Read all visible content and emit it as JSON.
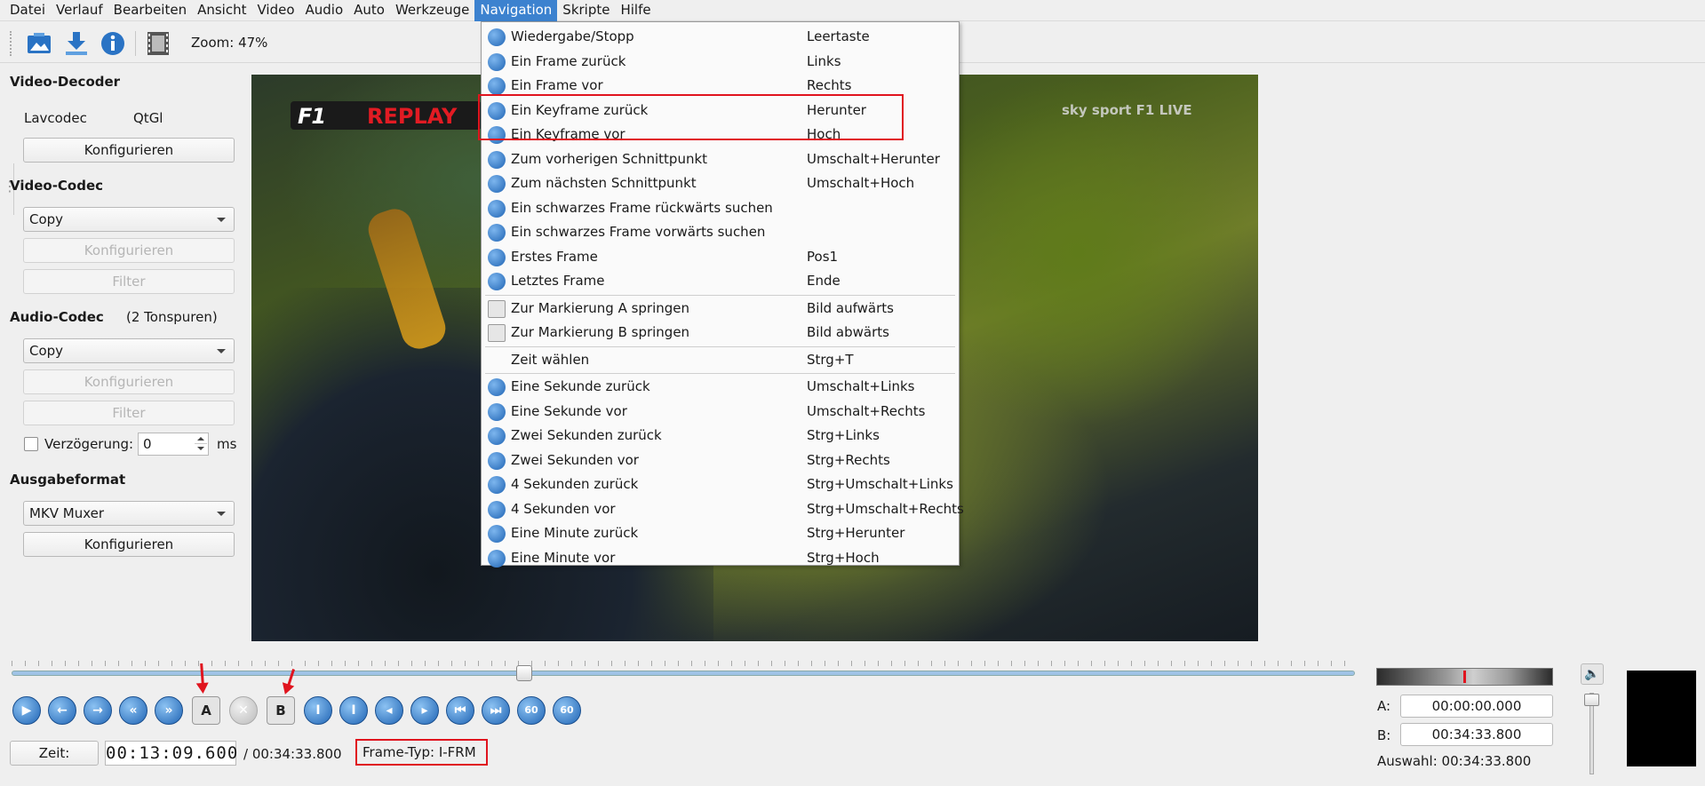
{
  "menubar": [
    "Datei",
    "Verlauf",
    "Bearbeiten",
    "Ansicht",
    "Video",
    "Audio",
    "Auto",
    "Werkzeuge",
    "Navigation",
    "Skripte",
    "Hilfe"
  ],
  "toolbar": {
    "zoom": "Zoom: 47%"
  },
  "left": {
    "video_decoder": "Video-Decoder",
    "lavcodec": "Lavcodec",
    "qtgl": "QtGl",
    "configure": "Konfigurieren",
    "video_codec": "Video-Codec",
    "copy": "Copy",
    "filter": "Filter",
    "audio_codec": "Audio-Codec",
    "tracks": "(2 Tonspuren)",
    "delay": "Verzögerung:",
    "delay_value": "0",
    "ms": "ms",
    "output_format": "Ausgabeformat",
    "muxer": "MKV Muxer"
  },
  "video": {
    "overlay_replay": "REPLAY",
    "overlay_f1": "F1",
    "overlay_channel": "sky sport F1 LIVE"
  },
  "navigation_menu": [
    {
      "label": "Wiedergabe/Stopp",
      "shortcut": "Leertaste",
      "icon": "play-icon"
    },
    {
      "label": "Ein Frame zurück",
      "shortcut": "Links",
      "icon": "frame-back-icon"
    },
    {
      "label": "Ein Frame vor",
      "shortcut": "Rechts",
      "icon": "frame-forward-icon"
    },
    {
      "label": "Ein Keyframe zurück",
      "shortcut": "Herunter",
      "icon": "keyframe-back-icon"
    },
    {
      "label": "Ein Keyframe vor",
      "shortcut": "Hoch",
      "icon": "keyframe-forward-icon"
    },
    {
      "label": "Zum vorherigen Schnittpunkt",
      "shortcut": "Umschalt+Herunter",
      "icon": "prev-cut-icon"
    },
    {
      "label": "Zum nächsten Schnittpunkt",
      "shortcut": "Umschalt+Hoch",
      "icon": "next-cut-icon"
    },
    {
      "label": "Ein schwarzes Frame rückwärts suchen",
      "shortcut": "",
      "icon": "black-frame-back-icon"
    },
    {
      "label": "Ein schwarzes Frame vorwärts suchen",
      "shortcut": "",
      "icon": "black-frame-forward-icon"
    },
    {
      "label": "Erstes Frame",
      "shortcut": "Pos1",
      "icon": "first-frame-icon"
    },
    {
      "label": "Letztes Frame",
      "shortcut": "Ende",
      "icon": "last-frame-icon"
    },
    {
      "label": "Zur Markierung A springen",
      "shortcut": "Bild aufwärts",
      "icon": "marker-a-icon"
    },
    {
      "label": "Zur Markierung B springen",
      "shortcut": "Bild abwärts",
      "icon": "marker-b-icon"
    },
    {
      "label": "Zeit wählen",
      "shortcut": "Strg+T",
      "icon": ""
    },
    {
      "label": "Eine Sekunde zurück",
      "shortcut": "Umschalt+Links",
      "icon": "second-back-icon"
    },
    {
      "label": "Eine Sekunde vor",
      "shortcut": "Umschalt+Rechts",
      "icon": "second-forward-icon"
    },
    {
      "label": "Zwei Sekunden zurück",
      "shortcut": "Strg+Links",
      "icon": "two-seconds-back-icon"
    },
    {
      "label": "Zwei Sekunden vor",
      "shortcut": "Strg+Rechts",
      "icon": "two-seconds-forward-icon"
    },
    {
      "label": "4 Sekunden zurück",
      "shortcut": "Strg+Umschalt+Links",
      "icon": "four-seconds-back-icon"
    },
    {
      "label": "4 Sekunden vor",
      "shortcut": "Strg+Umschalt+Rechts",
      "icon": "four-seconds-forward-icon"
    },
    {
      "label": "Eine Minute zurück",
      "shortcut": "Strg+Herunter",
      "icon": "minute-back-icon"
    },
    {
      "label": "Eine Minute vor",
      "shortcut": "Strg+Hoch",
      "icon": "minute-forward-icon"
    }
  ],
  "controls": {
    "marker_a": "A",
    "marker_b": "B",
    "sixty": "60",
    "zeit": "Zeit:",
    "current_time": "00:13:09.600",
    "total_time": "/ 00:34:33.800",
    "frame_type": "Frame-Typ:  I-FRM",
    "a_label": "A:",
    "a_value": "00:00:00.000",
    "b_label": "B:",
    "b_value": "00:34:33.800",
    "selection": "Auswahl: 00:34:33.800"
  },
  "colors": {
    "accent": "#3c82cf",
    "highlight": "#e0141e"
  }
}
